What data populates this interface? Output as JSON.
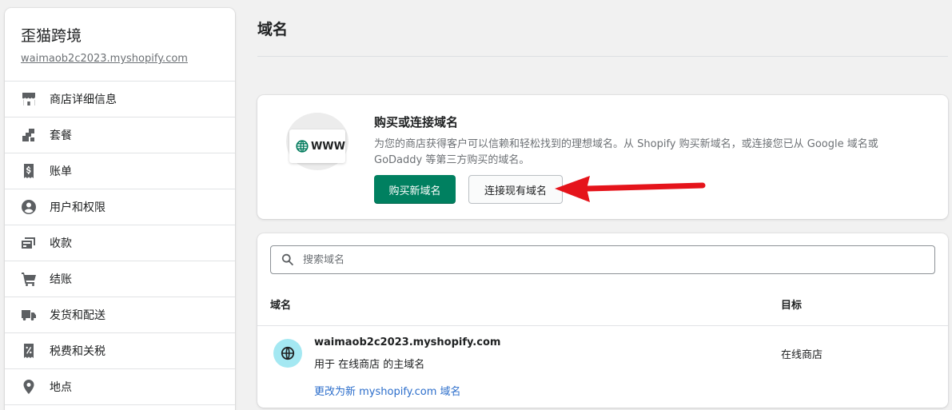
{
  "sidebar": {
    "store_name": "歪猫跨境",
    "store_url": "waimaob2c2023.myshopify.com",
    "items": [
      {
        "label": "商店详细信息",
        "icon": "store-icon"
      },
      {
        "label": "套餐",
        "icon": "plan-icon"
      },
      {
        "label": "账单",
        "icon": "billing-icon"
      },
      {
        "label": "用户和权限",
        "icon": "user-icon"
      },
      {
        "label": "收款",
        "icon": "payments-icon"
      },
      {
        "label": "结账",
        "icon": "cart-icon"
      },
      {
        "label": "发货和配送",
        "icon": "truck-icon"
      },
      {
        "label": "税费和关税",
        "icon": "tax-icon"
      },
      {
        "label": "地点",
        "icon": "location-icon"
      }
    ]
  },
  "page": {
    "title": "域名"
  },
  "buy_card": {
    "illustration_text": "WWW",
    "title": "购买或连接域名",
    "description": "为您的商店获得客户可以信赖和轻松找到的理想域名。从 Shopify 购买新域名，或连接您已从 Google 域名或 GoDaddy 等第三方购买的域名。",
    "buy_button": "购买新域名",
    "connect_button": "连接现有域名",
    "primary_color": "#008060",
    "annotation_color": "#e5141b"
  },
  "domains": {
    "search_placeholder": "搜索域名",
    "columns": {
      "domain": "域名",
      "target": "目标"
    },
    "rows": [
      {
        "domain": "waimaob2c2023.myshopify.com",
        "usage": "用于 在线商店 的主域名",
        "change_link": "更改为新 myshopify.com 域名",
        "target": "在线商店"
      }
    ]
  }
}
